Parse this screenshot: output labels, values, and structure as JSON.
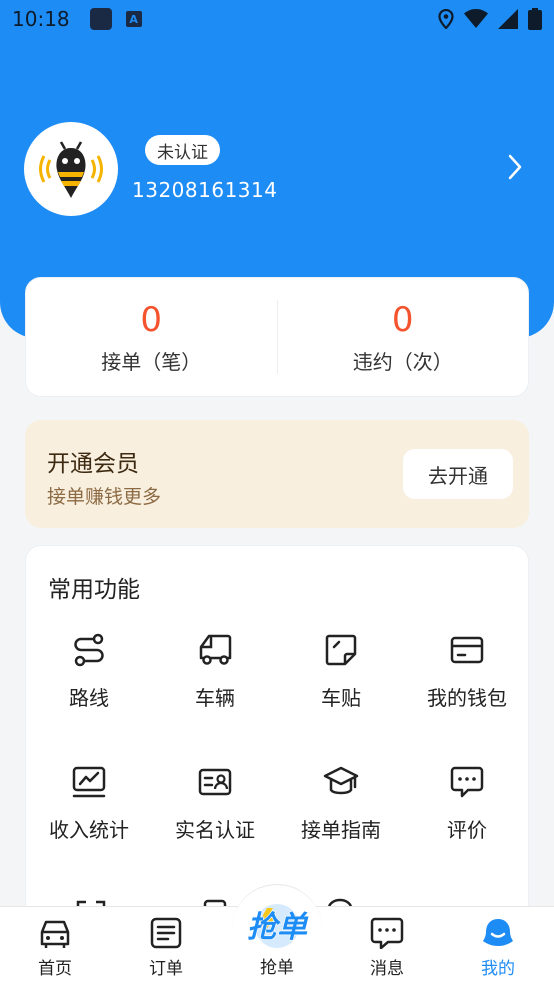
{
  "status_bar": {
    "time": "10:18",
    "a_glyph": "A"
  },
  "profile": {
    "badge": "未认证",
    "phone": "13208161314"
  },
  "stats": [
    {
      "value": "0",
      "label": "接单（笔）"
    },
    {
      "value": "0",
      "label": "违约（次）"
    }
  ],
  "membership": {
    "title": "开通会员",
    "subtitle": "接单赚钱更多",
    "button": "去开通"
  },
  "functions": {
    "title": "常用功能",
    "items": [
      {
        "label": "路线",
        "icon": "route-icon"
      },
      {
        "label": "车辆",
        "icon": "truck-icon"
      },
      {
        "label": "车贴",
        "icon": "sticker-icon"
      },
      {
        "label": "我的钱包",
        "icon": "wallet-icon"
      },
      {
        "label": "收入统计",
        "icon": "chart-icon"
      },
      {
        "label": "实名认证",
        "icon": "id-card-icon"
      },
      {
        "label": "接单指南",
        "icon": "graduation-cap-icon"
      },
      {
        "label": "评价",
        "icon": "comment-icon"
      }
    ]
  },
  "tabbar": {
    "items": [
      {
        "label": "首页",
        "icon": "car-icon"
      },
      {
        "label": "订单",
        "icon": "order-list-icon"
      },
      {
        "label": "抢单",
        "icon": "grab-order-icon",
        "logo_text": "抢单"
      },
      {
        "label": "消息",
        "icon": "message-icon"
      },
      {
        "label": "我的",
        "icon": "profile-icon"
      }
    ],
    "active_color": "#1e8cf5"
  },
  "colors": {
    "header": "#1e8cf5",
    "stat_value": "#f5532d",
    "member_bg": "#f8efdf"
  }
}
